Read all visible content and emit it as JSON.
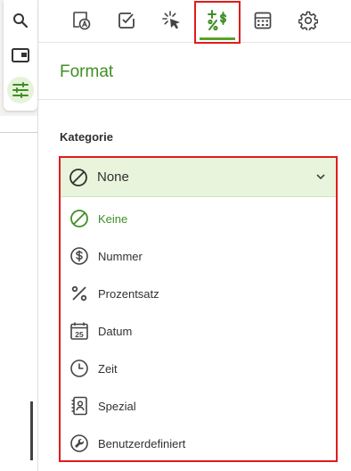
{
  "rail": {
    "items": [
      {
        "name": "search-icon"
      },
      {
        "name": "panel-icon"
      },
      {
        "name": "sliders-icon",
        "active": true
      }
    ]
  },
  "tabs": [
    {
      "name": "tab-text-format",
      "icon": "text-format-icon"
    },
    {
      "name": "tab-validation",
      "icon": "checkbox-icon"
    },
    {
      "name": "tab-interactions",
      "icon": "click-icon"
    },
    {
      "name": "tab-number-format",
      "icon": "number-format-icon",
      "active": true
    },
    {
      "name": "tab-calculator",
      "icon": "calculator-icon"
    },
    {
      "name": "tab-settings",
      "icon": "gear-icon"
    }
  ],
  "panel": {
    "title": "Format",
    "category_label": "Kategorie"
  },
  "dropdown": {
    "selected_value": "None",
    "options": [
      {
        "label": "Keine",
        "icon": "none-icon",
        "selected": true
      },
      {
        "label": "Nummer",
        "icon": "dollar-circle-icon"
      },
      {
        "label": "Prozentsatz",
        "icon": "percent-icon"
      },
      {
        "label": "Datum",
        "icon": "calendar-icon"
      },
      {
        "label": "Zeit",
        "icon": "clock-icon"
      },
      {
        "label": "Spezial",
        "icon": "contact-card-icon"
      },
      {
        "label": "Benutzerdefiniert",
        "icon": "wrench-icon"
      }
    ]
  },
  "colors": {
    "accent": "#3f8f25",
    "highlight": "#e01c1c",
    "selected_bg": "#e8f5dc"
  }
}
